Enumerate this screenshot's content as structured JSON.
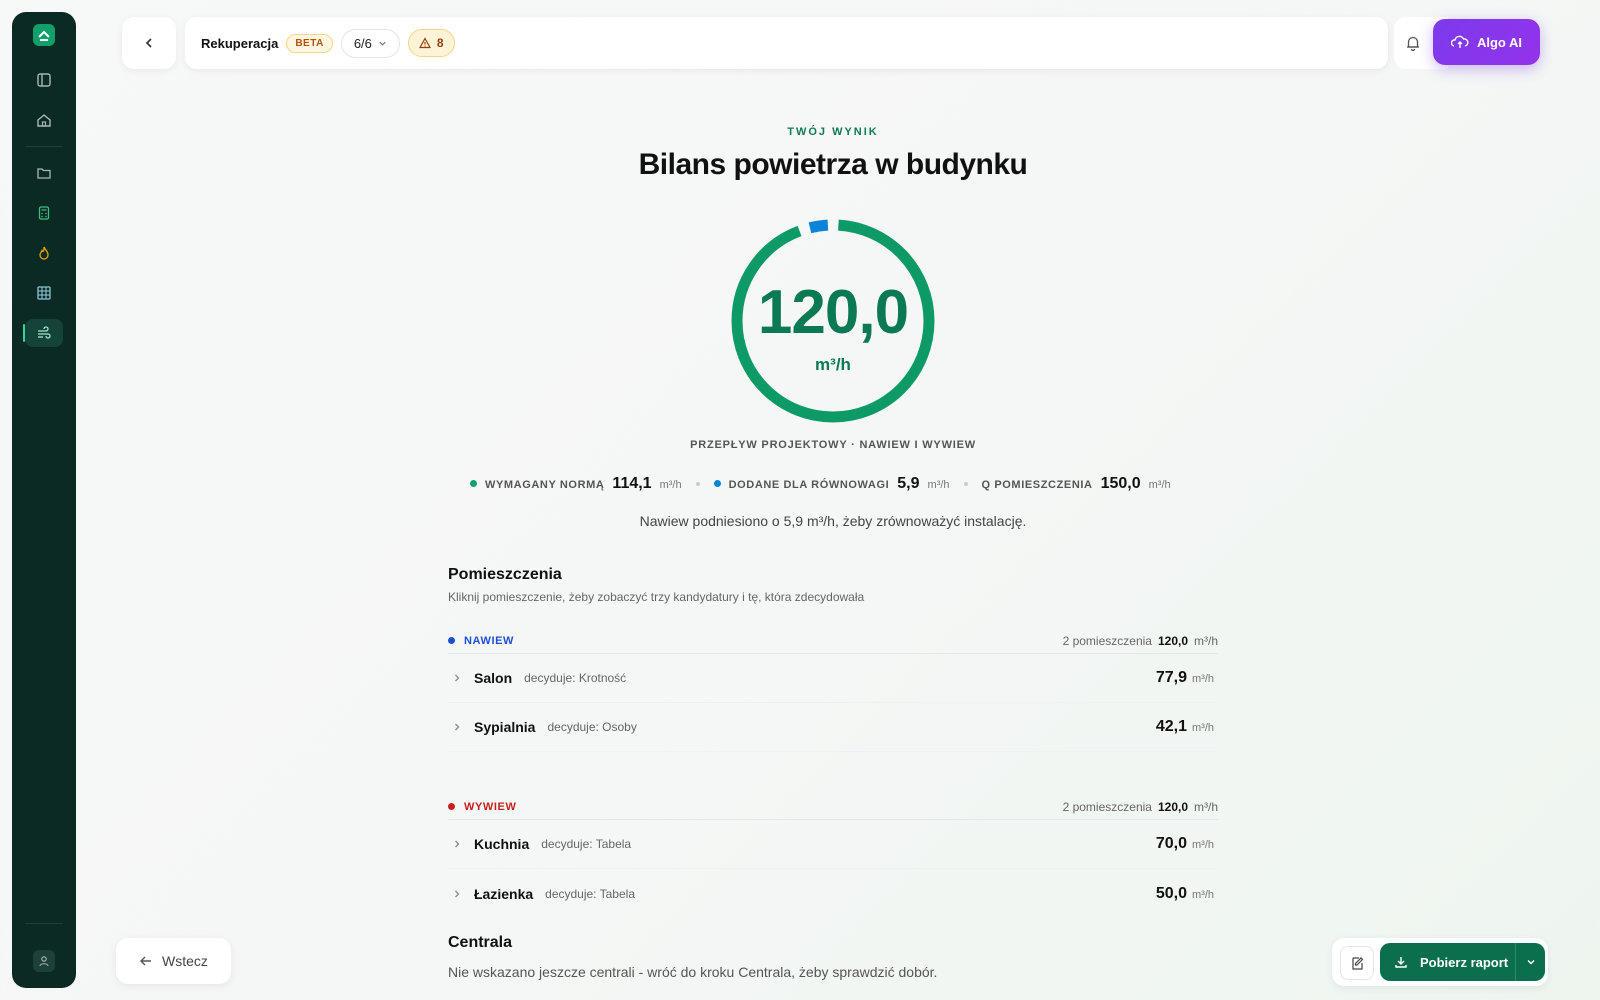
{
  "header": {
    "title": "Rekuperacja",
    "beta": "BETA",
    "step": "6/6",
    "warnings": "8",
    "ai_label": "Algo AI"
  },
  "result": {
    "eyebrow": "TWÓJ WYNIK",
    "title": "Bilans powietrza w budynku",
    "value": "120,0",
    "unit": "m³/h",
    "gauge_fraction_main": 0.952,
    "gauge_fraction_added": 0.048,
    "flow_label": "PRZEPŁYW PROJEKTOWY · NAWIEW I WYWIEW",
    "note": "Nawiew podniesiono o 5,9 m³/h, żeby zrównoważyć instalację."
  },
  "stats": [
    {
      "label": "WYMAGANY NORMĄ",
      "value": "114,1",
      "unit": "m³/h",
      "color": "#10a06a"
    },
    {
      "label": "DODANE DLA RÓWNOWAGI",
      "value": "5,9",
      "unit": "m³/h",
      "color": "#0a84d6"
    },
    {
      "label": "Q POMIESZCZENIA",
      "value": "150,0",
      "unit": "m³/h",
      "color": ""
    }
  ],
  "rooms": {
    "title": "Pomieszczenia",
    "subtitle": "Kliknij pomieszczenie, żeby zobaczyć trzy kandydatury i tę, która zdecydowała",
    "groups": [
      {
        "name": "NAWIEW",
        "color": "#1d4ed8",
        "count": "2 pomieszczenia",
        "sum": "120,0",
        "unit": "m³/h",
        "items": [
          {
            "name": "Salon",
            "decides": "decyduje: Krotność",
            "value": "77,9",
            "unit": "m³/h"
          },
          {
            "name": "Sypialnia",
            "decides": "decyduje: Osoby",
            "value": "42,1",
            "unit": "m³/h"
          }
        ]
      },
      {
        "name": "WYWIEW",
        "color": "#c81e1e",
        "count": "2 pomieszczenia",
        "sum": "120,0",
        "unit": "m³/h",
        "items": [
          {
            "name": "Kuchnia",
            "decides": "decyduje: Tabela",
            "value": "70,0",
            "unit": "m³/h"
          },
          {
            "name": "Łazienka",
            "decides": "decyduje: Tabela",
            "value": "50,0",
            "unit": "m³/h"
          }
        ]
      }
    ]
  },
  "central": {
    "title": "Centrala",
    "text": "Nie wskazano jeszcze centrali - wróć do kroku Centrala, żeby sprawdzić dobór."
  },
  "footer": {
    "back": "Wstecz",
    "report": "Pobierz raport"
  },
  "colors": {
    "accent": "#0b7a52",
    "gauge_main": "#0e9a67",
    "gauge_added": "#0a84d6",
    "ai": "#7c3aed"
  }
}
